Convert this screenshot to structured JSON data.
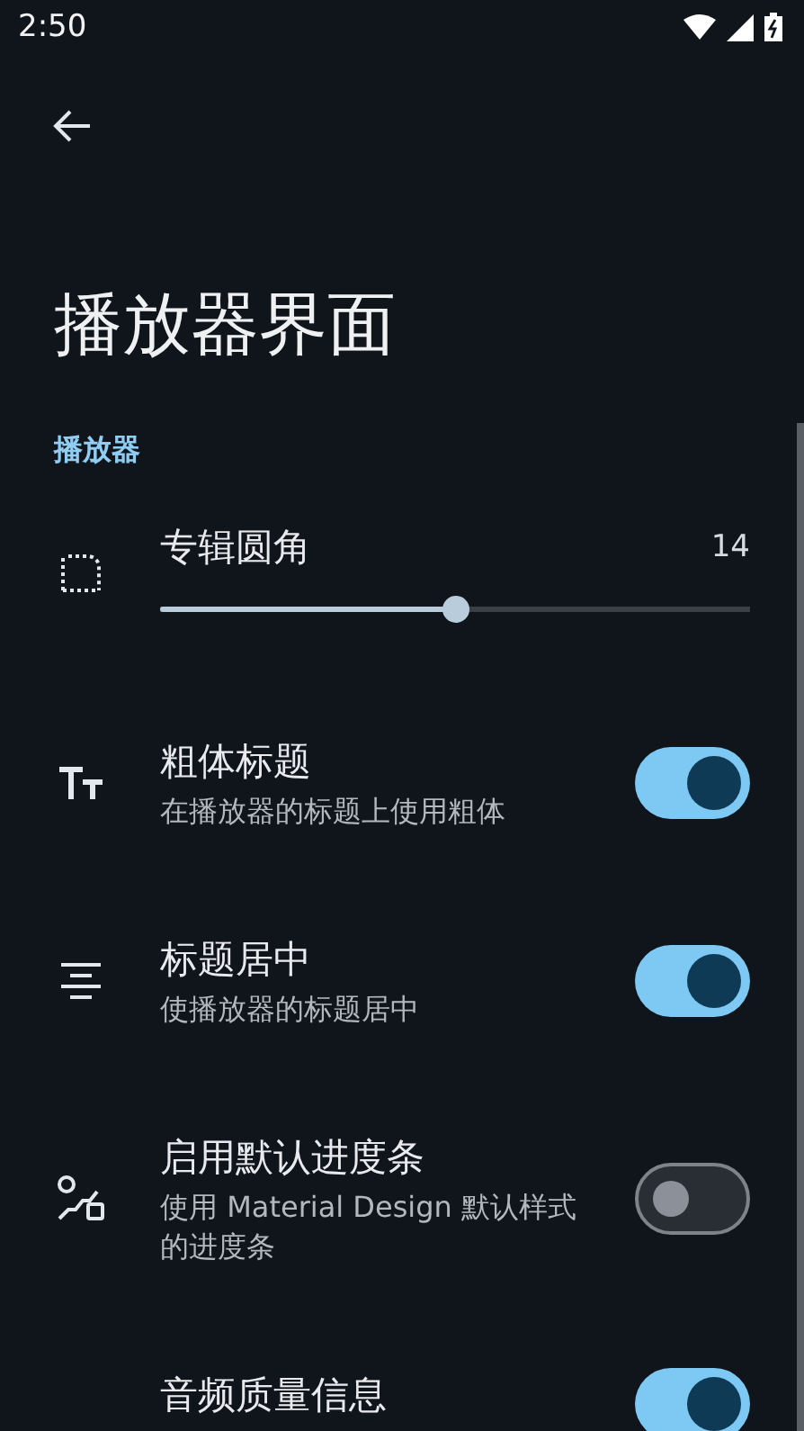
{
  "status_bar": {
    "time": "2:50"
  },
  "title": "播放器界面",
  "section": {
    "label": "播放器"
  },
  "settings": [
    {
      "kind": "slider",
      "title": "专辑圆角",
      "reading": "14",
      "level": 0.5
    },
    {
      "kind": "switch",
      "title": "粗体标题",
      "subtitle": "在播放器的标题上使用粗体",
      "on": true
    },
    {
      "kind": "switch",
      "title": "标题居中",
      "subtitle": "使播放器的标题居中",
      "on": true
    },
    {
      "kind": "switch",
      "title": "启用默认进度条",
      "subtitle": "使用 Material Design 默认样式的进度条",
      "on": false
    },
    {
      "kind": "switch",
      "title": "音频质量信息",
      "on": true
    }
  ]
}
